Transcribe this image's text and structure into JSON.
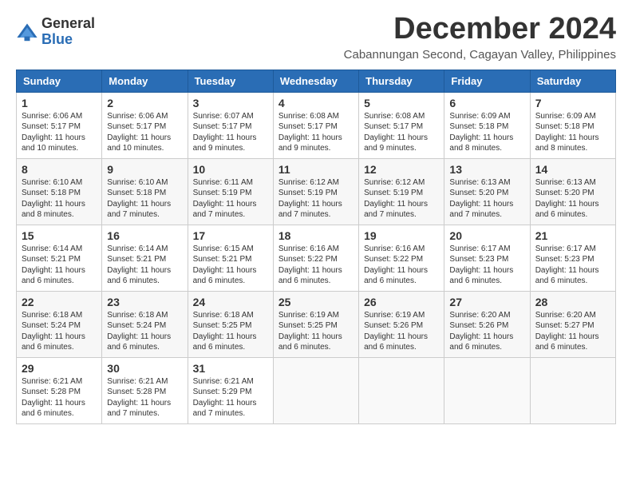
{
  "header": {
    "logo_general": "General",
    "logo_blue": "Blue",
    "month_title": "December 2024",
    "location": "Cabannungan Second, Cagayan Valley, Philippines"
  },
  "days_of_week": [
    "Sunday",
    "Monday",
    "Tuesday",
    "Wednesday",
    "Thursday",
    "Friday",
    "Saturday"
  ],
  "weeks": [
    [
      {
        "day": "1",
        "sunrise": "6:06 AM",
        "sunset": "5:17 PM",
        "daylight": "11 hours and 10 minutes."
      },
      {
        "day": "2",
        "sunrise": "6:06 AM",
        "sunset": "5:17 PM",
        "daylight": "11 hours and 10 minutes."
      },
      {
        "day": "3",
        "sunrise": "6:07 AM",
        "sunset": "5:17 PM",
        "daylight": "11 hours and 9 minutes."
      },
      {
        "day": "4",
        "sunrise": "6:08 AM",
        "sunset": "5:17 PM",
        "daylight": "11 hours and 9 minutes."
      },
      {
        "day": "5",
        "sunrise": "6:08 AM",
        "sunset": "5:17 PM",
        "daylight": "11 hours and 9 minutes."
      },
      {
        "day": "6",
        "sunrise": "6:09 AM",
        "sunset": "5:18 PM",
        "daylight": "11 hours and 8 minutes."
      },
      {
        "day": "7",
        "sunrise": "6:09 AM",
        "sunset": "5:18 PM",
        "daylight": "11 hours and 8 minutes."
      }
    ],
    [
      {
        "day": "8",
        "sunrise": "6:10 AM",
        "sunset": "5:18 PM",
        "daylight": "11 hours and 8 minutes."
      },
      {
        "day": "9",
        "sunrise": "6:10 AM",
        "sunset": "5:18 PM",
        "daylight": "11 hours and 7 minutes."
      },
      {
        "day": "10",
        "sunrise": "6:11 AM",
        "sunset": "5:19 PM",
        "daylight": "11 hours and 7 minutes."
      },
      {
        "day": "11",
        "sunrise": "6:12 AM",
        "sunset": "5:19 PM",
        "daylight": "11 hours and 7 minutes."
      },
      {
        "day": "12",
        "sunrise": "6:12 AM",
        "sunset": "5:19 PM",
        "daylight": "11 hours and 7 minutes."
      },
      {
        "day": "13",
        "sunrise": "6:13 AM",
        "sunset": "5:20 PM",
        "daylight": "11 hours and 7 minutes."
      },
      {
        "day": "14",
        "sunrise": "6:13 AM",
        "sunset": "5:20 PM",
        "daylight": "11 hours and 6 minutes."
      }
    ],
    [
      {
        "day": "15",
        "sunrise": "6:14 AM",
        "sunset": "5:21 PM",
        "daylight": "11 hours and 6 minutes."
      },
      {
        "day": "16",
        "sunrise": "6:14 AM",
        "sunset": "5:21 PM",
        "daylight": "11 hours and 6 minutes."
      },
      {
        "day": "17",
        "sunrise": "6:15 AM",
        "sunset": "5:21 PM",
        "daylight": "11 hours and 6 minutes."
      },
      {
        "day": "18",
        "sunrise": "6:16 AM",
        "sunset": "5:22 PM",
        "daylight": "11 hours and 6 minutes."
      },
      {
        "day": "19",
        "sunrise": "6:16 AM",
        "sunset": "5:22 PM",
        "daylight": "11 hours and 6 minutes."
      },
      {
        "day": "20",
        "sunrise": "6:17 AM",
        "sunset": "5:23 PM",
        "daylight": "11 hours and 6 minutes."
      },
      {
        "day": "21",
        "sunrise": "6:17 AM",
        "sunset": "5:23 PM",
        "daylight": "11 hours and 6 minutes."
      }
    ],
    [
      {
        "day": "22",
        "sunrise": "6:18 AM",
        "sunset": "5:24 PM",
        "daylight": "11 hours and 6 minutes."
      },
      {
        "day": "23",
        "sunrise": "6:18 AM",
        "sunset": "5:24 PM",
        "daylight": "11 hours and 6 minutes."
      },
      {
        "day": "24",
        "sunrise": "6:18 AM",
        "sunset": "5:25 PM",
        "daylight": "11 hours and 6 minutes."
      },
      {
        "day": "25",
        "sunrise": "6:19 AM",
        "sunset": "5:25 PM",
        "daylight": "11 hours and 6 minutes."
      },
      {
        "day": "26",
        "sunrise": "6:19 AM",
        "sunset": "5:26 PM",
        "daylight": "11 hours and 6 minutes."
      },
      {
        "day": "27",
        "sunrise": "6:20 AM",
        "sunset": "5:26 PM",
        "daylight": "11 hours and 6 minutes."
      },
      {
        "day": "28",
        "sunrise": "6:20 AM",
        "sunset": "5:27 PM",
        "daylight": "11 hours and 6 minutes."
      }
    ],
    [
      {
        "day": "29",
        "sunrise": "6:21 AM",
        "sunset": "5:28 PM",
        "daylight": "11 hours and 6 minutes."
      },
      {
        "day": "30",
        "sunrise": "6:21 AM",
        "sunset": "5:28 PM",
        "daylight": "11 hours and 7 minutes."
      },
      {
        "day": "31",
        "sunrise": "6:21 AM",
        "sunset": "5:29 PM",
        "daylight": "11 hours and 7 minutes."
      },
      null,
      null,
      null,
      null
    ]
  ]
}
